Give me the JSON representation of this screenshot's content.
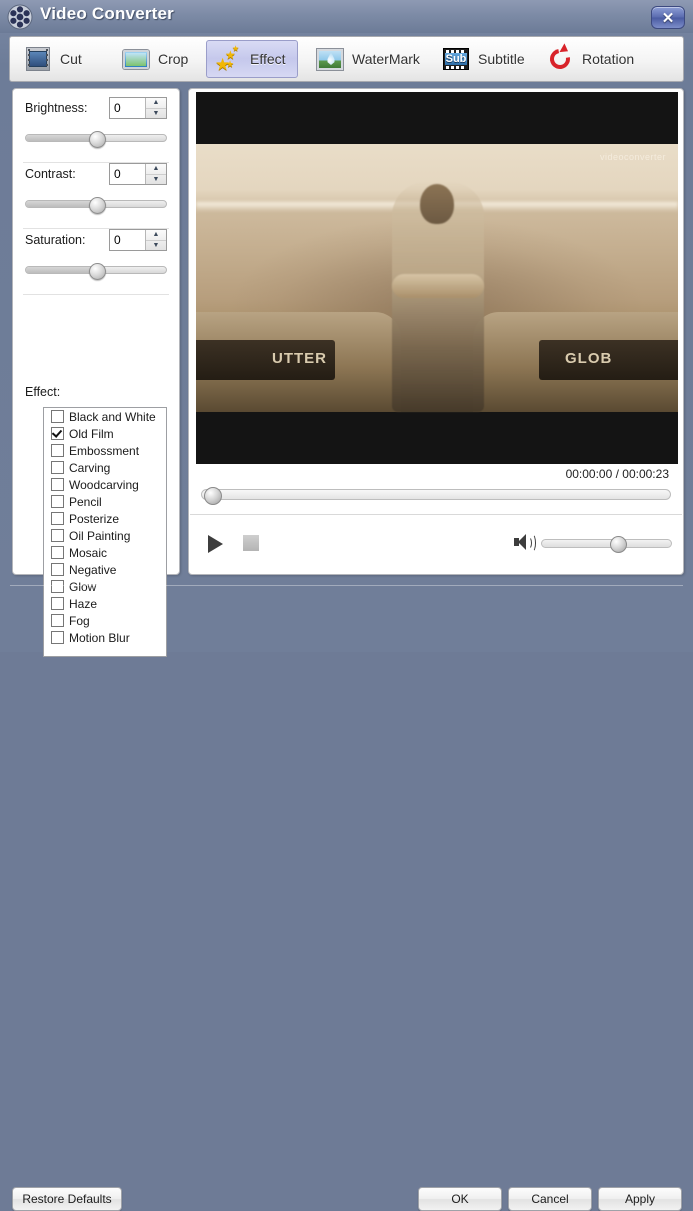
{
  "window": {
    "title": "Video Converter",
    "logo_icon": "film-reel-icon",
    "close_label": "✕"
  },
  "tabs": [
    {
      "id": "cut",
      "label": "Cut",
      "icon": "film-cut-icon",
      "active": false
    },
    {
      "id": "crop",
      "label": "Crop",
      "icon": "crop-frame-icon",
      "active": false
    },
    {
      "id": "effect",
      "label": "Effect",
      "icon": "stars-icon",
      "active": true
    },
    {
      "id": "watermark",
      "label": "WaterMark",
      "icon": "water-drop-icon",
      "active": false
    },
    {
      "id": "subtitle",
      "label": "Subtitle",
      "icon": "subtitle-icon",
      "active": false
    },
    {
      "id": "rotation",
      "label": "Rotation",
      "icon": "rotate-icon",
      "active": false
    }
  ],
  "adjustments": [
    {
      "id": "brightness",
      "label": "Brightness:",
      "value": "0",
      "slider_percent": 50
    },
    {
      "id": "contrast",
      "label": "Contrast:",
      "value": "0",
      "slider_percent": 50
    },
    {
      "id": "saturation",
      "label": "Saturation:",
      "value": "0",
      "slider_percent": 50
    }
  ],
  "spinner": {
    "up_glyph": "▲",
    "down_glyph": "▼"
  },
  "effects": {
    "label": "Effect:",
    "items": [
      {
        "label": "Black and White",
        "checked": false
      },
      {
        "label": "Old Film",
        "checked": true
      },
      {
        "label": "Embossment",
        "checked": false
      },
      {
        "label": "Carving",
        "checked": false
      },
      {
        "label": "Woodcarving",
        "checked": false
      },
      {
        "label": "Pencil",
        "checked": false
      },
      {
        "label": "Posterize",
        "checked": false
      },
      {
        "label": "Oil Painting",
        "checked": false
      },
      {
        "label": "Mosaic",
        "checked": false
      },
      {
        "label": "Negative",
        "checked": false
      },
      {
        "label": "Glow",
        "checked": false
      },
      {
        "label": "Haze",
        "checked": false
      },
      {
        "label": "Fog",
        "checked": false
      },
      {
        "label": "Motion Blur",
        "checked": false
      }
    ]
  },
  "preview": {
    "watermark_text": "videoconverter",
    "plate_left_text": "UTTER",
    "plate_right_text": "GLOB",
    "current_time": "00:00:00",
    "separator": "/",
    "total_time": "00:00:23",
    "timecode": "00:00:00  /  00:00:23",
    "seek_percent": 0,
    "volume_percent": 58,
    "play_icon": "play-icon",
    "stop_icon": "stop-icon",
    "volume_icon": "speaker-icon"
  },
  "footer": {
    "restore_defaults": "Restore Defaults",
    "ok": "OK",
    "cancel": "Cancel",
    "apply": "Apply"
  },
  "colors": {
    "window_chrome": "#6e7b96",
    "titlebar_text": "#ffffff",
    "active_tab": "#c5c8ec",
    "panel_bg": "#ffffff",
    "close_button": "#4a5ba2"
  }
}
